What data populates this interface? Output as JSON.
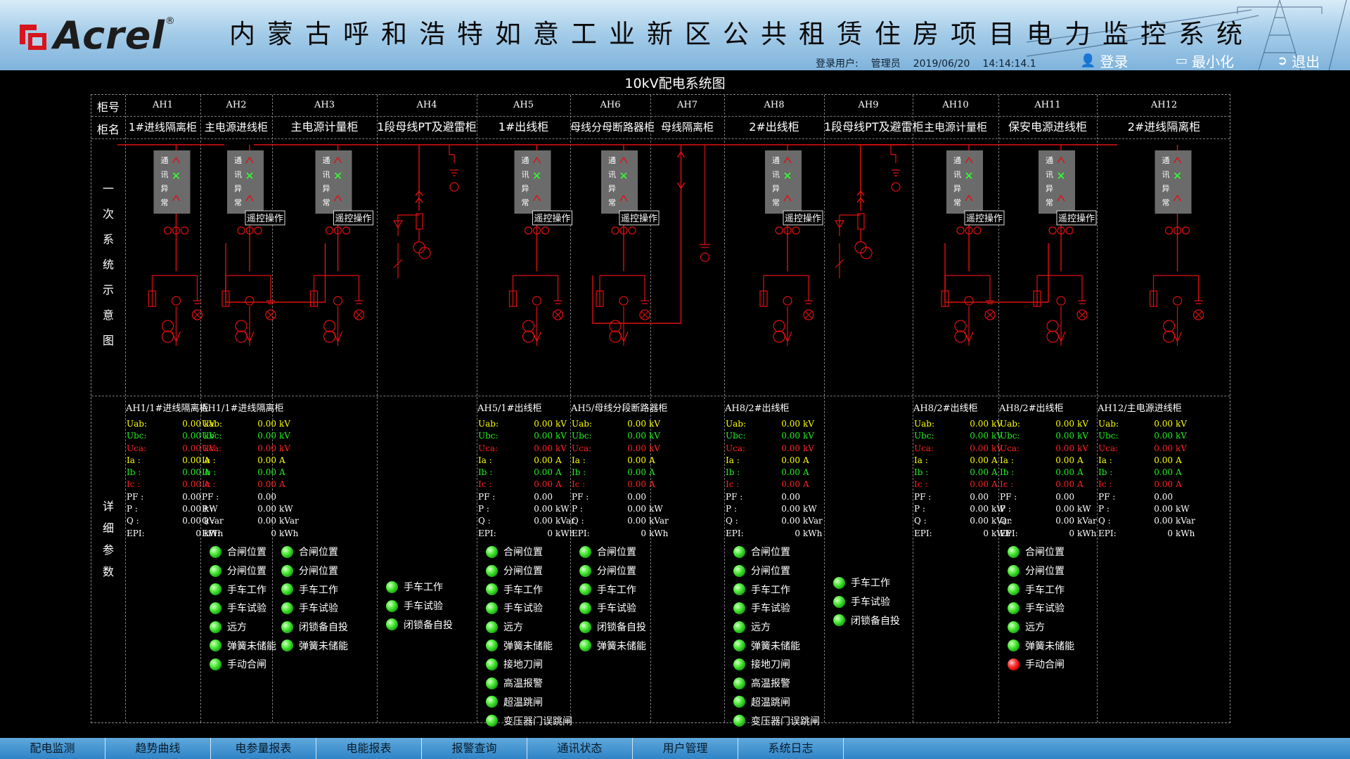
{
  "header": {
    "logo_text": "Acrel",
    "logo_reg": "®",
    "title": "内蒙古呼和浩特如意工业新区公共租赁住房项目电力监控系统",
    "login_user_label": "登录用户:",
    "login_user": "管理员",
    "date": "2019/06/20",
    "time": "14:14:14.1",
    "buttons": {
      "login": "登录",
      "minimize": "最小化",
      "exit": "退出"
    }
  },
  "page_title": "10kV配电系统图",
  "row_labels": {
    "cabinet_no": "柜号",
    "cabinet_name": "柜名",
    "primary": [
      "一",
      "次",
      "系",
      "统",
      "示",
      "意",
      "图"
    ],
    "detail": [
      "详",
      "细",
      "参",
      "数"
    ]
  },
  "cabinets": [
    {
      "id": "AH1",
      "name": "1#进线隔离柜"
    },
    {
      "id": "AH2",
      "name": "主电源进线柜"
    },
    {
      "id": "AH3",
      "name": "主电源计量柜"
    },
    {
      "id": "AH4",
      "name": "1段母线PT及避雷柜"
    },
    {
      "id": "AH5",
      "name": "1#出线柜"
    },
    {
      "id": "AH6",
      "name": "母线分母断路器柜"
    },
    {
      "id": "AH7",
      "name": "母线隔离柜"
    },
    {
      "id": "AH8",
      "name": "2#出线柜"
    },
    {
      "id": "AH9",
      "name": "1段母线PT及避雷柜"
    },
    {
      "id": "AH10",
      "name": "主电源计量柜"
    },
    {
      "id": "AH11",
      "name": "保安电源进线柜"
    },
    {
      "id": "AH12",
      "name": "2#进线隔离柜"
    }
  ],
  "comm_status_text": [
    "通",
    "讯",
    "异",
    "常"
  ],
  "remote_button_label": "遥控操作",
  "param_labels": [
    "Uab:",
    "Ubc:",
    "Uca:",
    "Ia :",
    "Ib :",
    "Ic :",
    "PF :",
    "P  :",
    "Q  :",
    "EPI:"
  ],
  "param_values": [
    "0.00",
    "0.00",
    "0.00",
    "0.00",
    "0.00",
    "0.00",
    "0.00",
    "0.00",
    "0.00",
    "0"
  ],
  "param_units": [
    "kV",
    "kV",
    "kV",
    "A",
    "A",
    "A",
    "",
    "kW",
    "kVar",
    "kWh"
  ],
  "param_colors": [
    "#ffff00",
    "#22ee22",
    "#ff2222",
    "#ffff00",
    "#22ee22",
    "#ff2222",
    "#ffffff",
    "#ffffff",
    "#ffffff",
    "#ffffff"
  ],
  "param_blocks": [
    {
      "title": "AH1/1#进线隔离柜"
    },
    {
      "title": "AH1/1#进线隔离柜"
    },
    {
      "title": "AH5/1#出线柜"
    },
    {
      "title": "AH5/母线分段断路器柜"
    },
    {
      "title": "AH8/2#出线柜"
    },
    {
      "title": "AH8/2#出线柜"
    },
    {
      "title": "AH8/2#出线柜"
    },
    {
      "title": "AH12/主电源进线柜"
    }
  ],
  "indicator_groups": [
    {
      "items": [
        {
          "label": "合闸位置",
          "state": "green"
        },
        {
          "label": "分闸位置",
          "state": "green"
        },
        {
          "label": "手车工作",
          "state": "green"
        },
        {
          "label": "手车试验",
          "state": "green"
        },
        {
          "label": "远方",
          "state": "green"
        },
        {
          "label": "弹簧未储能",
          "state": "green"
        },
        {
          "label": "手动合闸",
          "state": "green"
        }
      ]
    },
    {
      "items": [
        {
          "label": "合闸位置",
          "state": "green"
        },
        {
          "label": "分闸位置",
          "state": "green"
        },
        {
          "label": "手车工作",
          "state": "green"
        },
        {
          "label": "手车试验",
          "state": "green"
        },
        {
          "label": "闭锁备自投",
          "state": "green"
        },
        {
          "label": "弹簧未储能",
          "state": "green"
        }
      ]
    },
    {
      "items": [
        {
          "label": "手车工作",
          "state": "green"
        },
        {
          "label": "手车试验",
          "state": "green"
        },
        {
          "label": "闭锁备自投",
          "state": "green"
        }
      ]
    },
    {
      "items": [
        {
          "label": "合闸位置",
          "state": "green"
        },
        {
          "label": "分闸位置",
          "state": "green"
        },
        {
          "label": "手车工作",
          "state": "green"
        },
        {
          "label": "手车试验",
          "state": "green"
        },
        {
          "label": "远方",
          "state": "green"
        },
        {
          "label": "弹簧未储能",
          "state": "green"
        },
        {
          "label": "接地刀闸",
          "state": "green"
        },
        {
          "label": "高温报警",
          "state": "green"
        },
        {
          "label": "超温跳闸",
          "state": "green"
        },
        {
          "label": "变压器门误跳闸",
          "state": "green"
        }
      ]
    },
    {
      "items": [
        {
          "label": "合闸位置",
          "state": "green"
        },
        {
          "label": "分闸位置",
          "state": "green"
        },
        {
          "label": "手车工作",
          "state": "green"
        },
        {
          "label": "手车试验",
          "state": "green"
        },
        {
          "label": "闭锁备自投",
          "state": "green"
        },
        {
          "label": "弹簧未储能",
          "state": "green"
        }
      ]
    },
    {
      "items": [
        {
          "label": "合闸位置",
          "state": "green"
        },
        {
          "label": "分闸位置",
          "state": "green"
        },
        {
          "label": "手车工作",
          "state": "green"
        },
        {
          "label": "手车试验",
          "state": "green"
        },
        {
          "label": "远方",
          "state": "green"
        },
        {
          "label": "弹簧未储能",
          "state": "green"
        },
        {
          "label": "接地刀闸",
          "state": "green"
        },
        {
          "label": "高温报警",
          "state": "green"
        },
        {
          "label": "超温跳闸",
          "state": "green"
        },
        {
          "label": "变压器门误跳闸",
          "state": "green"
        }
      ]
    },
    {
      "items": [
        {
          "label": "手车工作",
          "state": "green"
        },
        {
          "label": "手车试验",
          "state": "green"
        },
        {
          "label": "闭锁备自投",
          "state": "green"
        }
      ]
    },
    {
      "items": [
        {
          "label": "合闸位置",
          "state": "green"
        },
        {
          "label": "分闸位置",
          "state": "green"
        },
        {
          "label": "手车工作",
          "state": "green"
        },
        {
          "label": "手车试验",
          "state": "green"
        },
        {
          "label": "远方",
          "state": "green"
        },
        {
          "label": "弹簧未储能",
          "state": "green"
        },
        {
          "label": "手动合闸",
          "state": "red"
        }
      ]
    }
  ],
  "nav": [
    "配电监测",
    "趋势曲线",
    "电参量报表",
    "电能报表",
    "报警查询",
    "通讯状态",
    "用户管理",
    "系统日志"
  ],
  "colors": {
    "bus": "#e01010",
    "led_on": "#22dd22",
    "led_alarm": "#ee1111",
    "nav_bg": "#3a8fd0",
    "header_bg": "#a6cde9"
  }
}
